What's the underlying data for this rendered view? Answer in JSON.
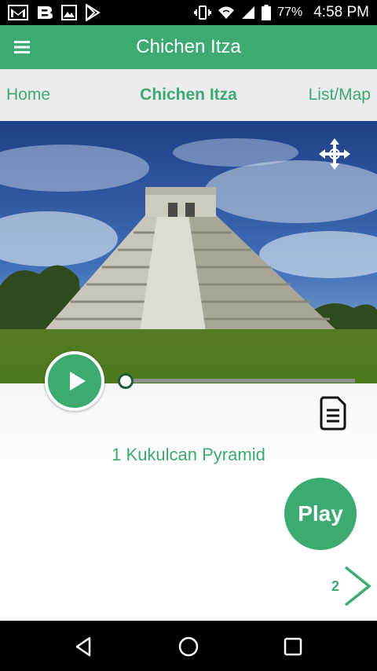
{
  "status_bar": {
    "battery_percent": "77%",
    "time": "4:58 PM",
    "left_icons": [
      "gmail-icon",
      "b-app-icon",
      "image-icon",
      "play-store-icon"
    ],
    "right_icons": [
      "vibrate-icon",
      "wifi-icon",
      "signal-icon",
      "battery-icon"
    ]
  },
  "app_bar": {
    "title": "Chichen Itza"
  },
  "nav": {
    "home": "Home",
    "current": "Chichen Itza",
    "list_map": "List/Map"
  },
  "player": {
    "progress": 0.0
  },
  "stop": {
    "title": "1 Kukulcan Pyramid",
    "play_label": "Play",
    "next_number": "2"
  },
  "colors": {
    "accent": "#3daa72",
    "nav_bar_bg": "#ececec",
    "status_bar_bg": "#000000"
  }
}
